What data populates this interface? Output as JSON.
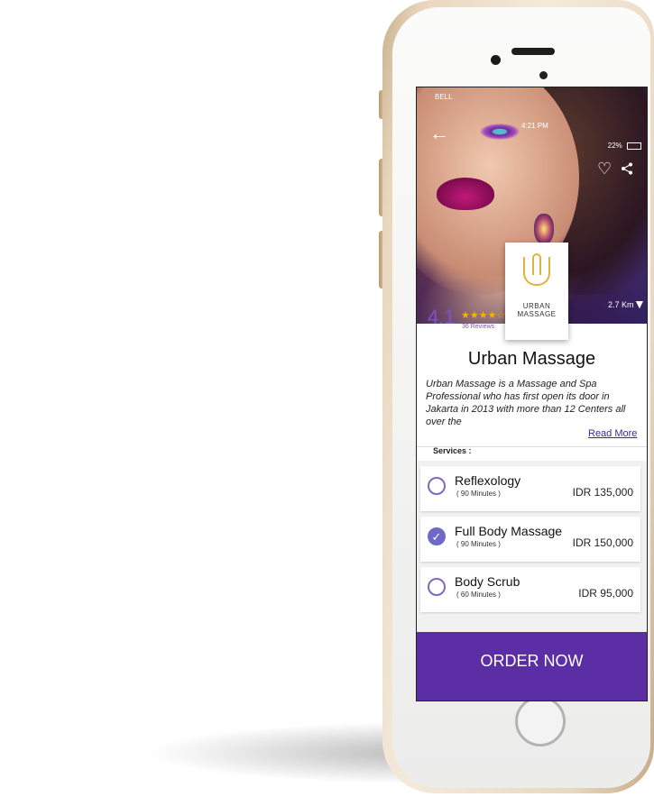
{
  "status_bar": {
    "carrier": "BELL",
    "time": "4:21 PM",
    "battery": "22%"
  },
  "hero": {
    "back_icon": "back-arrow-icon",
    "favorite_icon": "heart-icon",
    "share_icon": "share-icon",
    "distance": "2.7 Km",
    "pin_icon": "location-pin-icon"
  },
  "vendor": {
    "logo_text": "URBAN MASSAGE",
    "rating": "4.1",
    "stars": "★★★★☆",
    "reviews": "36 Reviews",
    "name": "Urban Massage",
    "description": "Urban Massage is a Massage and Spa Professional who has first open its door in Jakarta in 2013 with more than 12 Centers all over the",
    "read_more": "Read More"
  },
  "services": {
    "label": "Services :",
    "items": [
      {
        "name": "Reflexology",
        "duration": "( 90 Minutes )",
        "price": "IDR 135,000",
        "selected": false
      },
      {
        "name": "Full Body Massage",
        "duration": "( 90 Minutes )",
        "price": "IDR 150,000",
        "selected": true
      },
      {
        "name": "Body Scrub",
        "duration": "( 60 Minutes )",
        "price": "IDR 95,000",
        "selected": false
      }
    ]
  },
  "order_button": "ORDER NOW",
  "colors": {
    "accent": "#5b2ea6",
    "rating": "#7c52c9",
    "star": "#f5b400",
    "logo_gold": "#e2b33c"
  }
}
